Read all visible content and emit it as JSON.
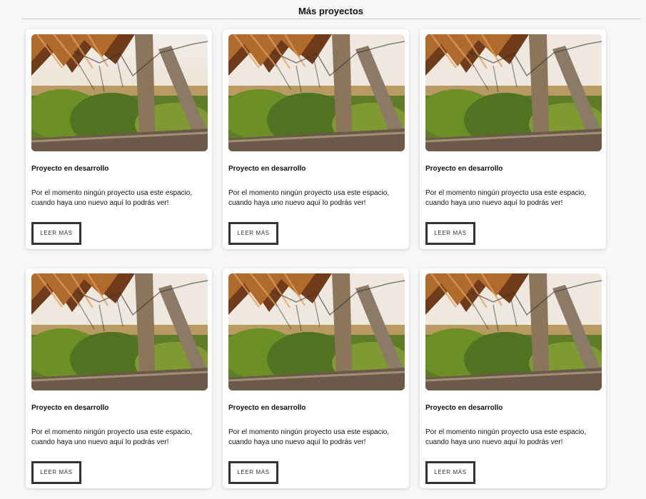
{
  "section": {
    "title": "Más proyectos"
  },
  "cards": [
    {
      "image": "project-photo-thatched-roof-and-wooden-posts",
      "title": "Proyecto en desarrollo",
      "description": "Por el momento ningún proyecto usa este espacio, cuando haya uno nuevo aquí lo podrás ver!",
      "button_label": "LEER MÁS"
    },
    {
      "image": "project-photo-thatched-roof-and-wooden-posts",
      "title": "Proyecto en desarrollo",
      "description": "Por el momento ningún proyecto usa este espacio, cuando haya uno nuevo aquí lo podrás ver!",
      "button_label": "LEER MÁS"
    },
    {
      "image": "project-photo-thatched-roof-and-wooden-posts",
      "title": "Proyecto en desarrollo",
      "description": "Por el momento ningún proyecto usa este espacio, cuando haya uno nuevo aquí lo podrás ver!",
      "button_label": "LEER MÁS"
    },
    {
      "image": "project-photo-thatched-roof-and-wooden-posts",
      "title": "Proyecto en desarrollo",
      "description": "Por el momento ningún proyecto usa este espacio, cuando haya uno nuevo aquí lo podrás ver!",
      "button_label": "LEER MÁS"
    },
    {
      "image": "project-photo-thatched-roof-and-wooden-posts",
      "title": "Proyecto en desarrollo",
      "description": "Por el momento ningún proyecto usa este espacio, cuando haya uno nuevo aquí lo podrás ver!",
      "button_label": "LEER MÁS"
    },
    {
      "image": "project-photo-thatched-roof-and-wooden-posts",
      "title": "Proyecto en desarrollo",
      "description": "Por el momento ningún proyecto usa este espacio, cuando haya uno nuevo aquí lo podrás ver!",
      "button_label": "LEER MÁS"
    }
  ]
}
